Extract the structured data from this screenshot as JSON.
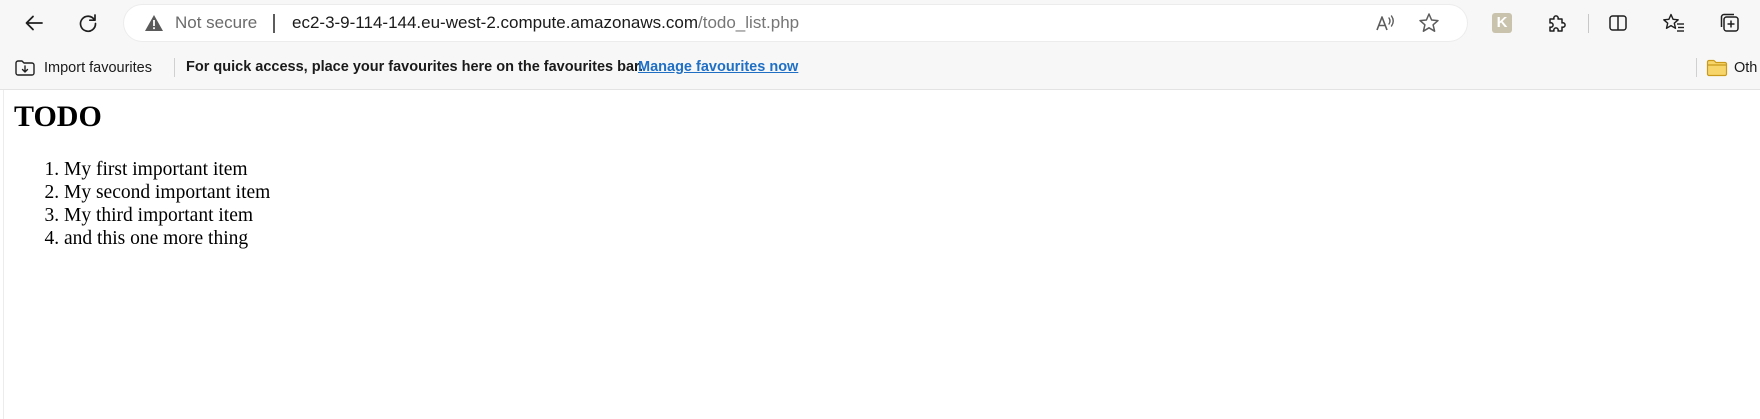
{
  "browser": {
    "security_label": "Not secure",
    "url_host": "ec2-3-9-114-144.eu-west-2.compute.amazonaws.com",
    "url_path": "/todo_list.php",
    "extension_letter": "K",
    "icons": [
      "back-icon",
      "refresh-icon",
      "warning-icon",
      "read-aloud-icon",
      "favorite-star-icon",
      "extensions-icon",
      "split-screen-icon",
      "favorites-icon",
      "collections-icon"
    ]
  },
  "favourites_bar": {
    "import_label": "Import favourites",
    "message": "For quick access, place your favourites here on the favourites bar.",
    "manage_link": "Manage favourites now",
    "other_label": "Oth"
  },
  "page": {
    "title": "TODO",
    "items": [
      "My first important item",
      "My second important item",
      "My third important item",
      "and this one more thing"
    ]
  },
  "colors": {
    "toolbar_bg": "#f7f7f7",
    "link": "#1f6fc5",
    "folder": "#f2c744"
  }
}
